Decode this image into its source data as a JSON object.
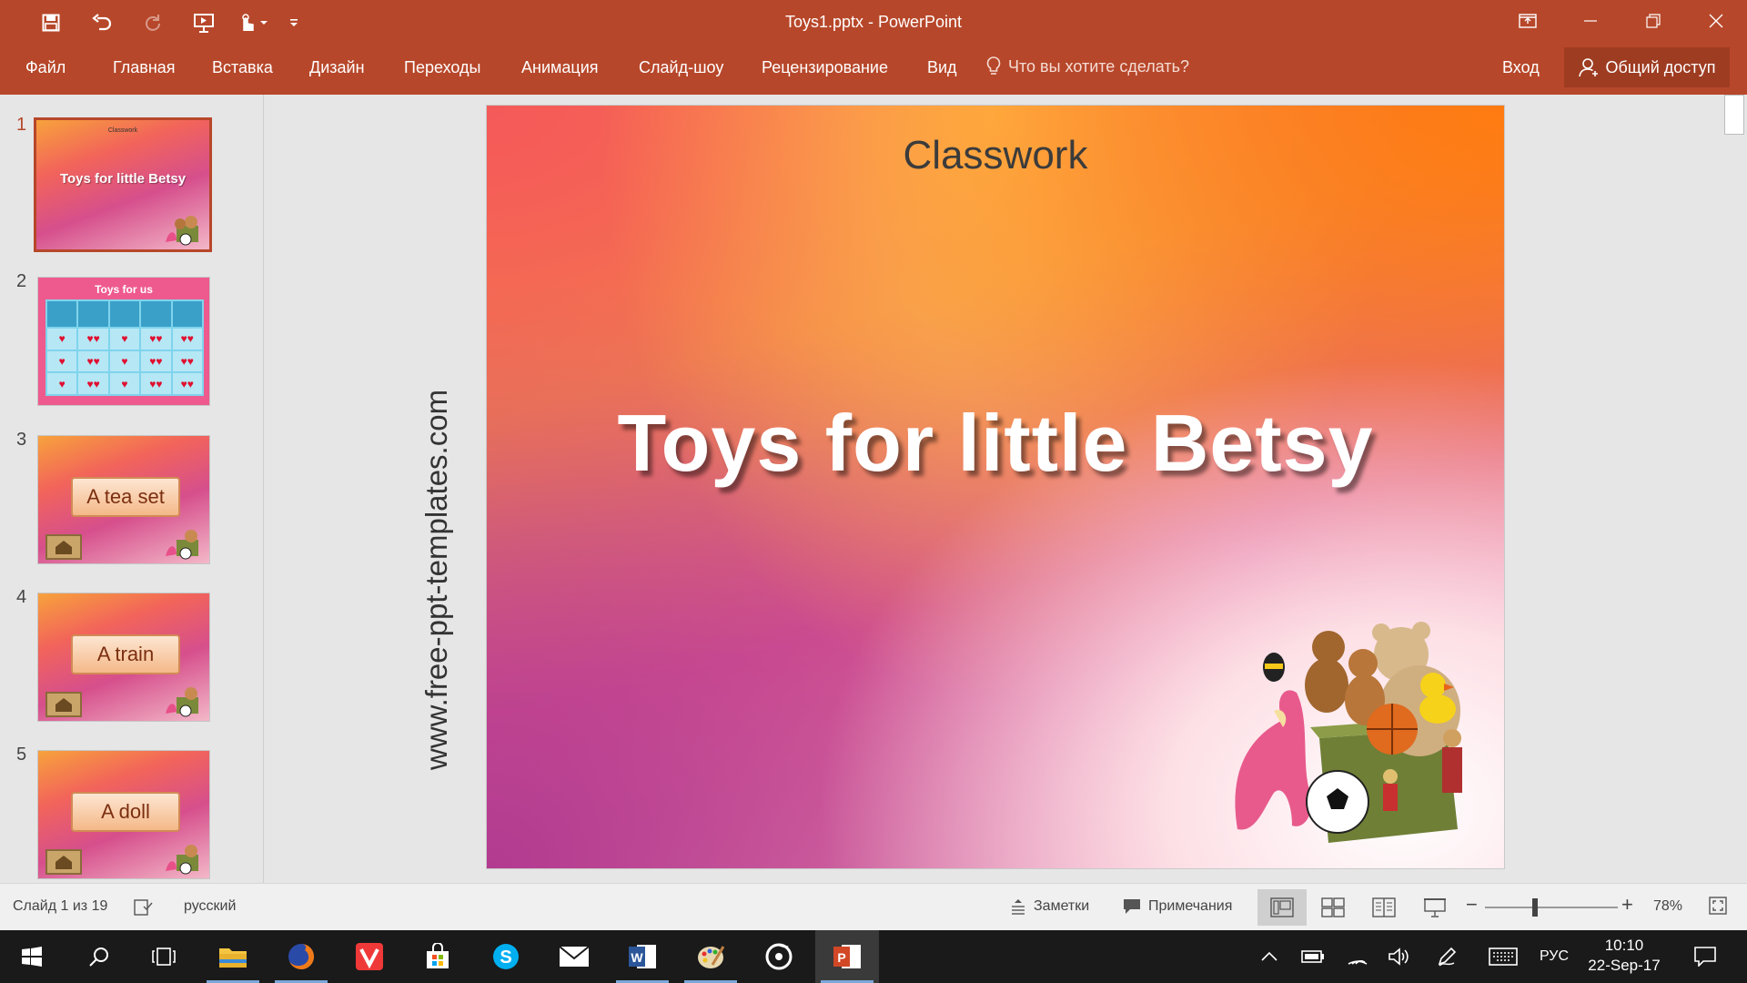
{
  "window": {
    "title": "Toys1.pptx - PowerPoint"
  },
  "quick_access": {
    "icons": [
      "save-icon",
      "undo-icon",
      "redo-icon",
      "start-from-beginning-icon",
      "touch-mode-icon",
      "customize-icon"
    ]
  },
  "ribbon_tabs": [
    {
      "label": "Файл"
    },
    {
      "label": "Главная"
    },
    {
      "label": "Вставка"
    },
    {
      "label": "Дизайн"
    },
    {
      "label": "Переходы"
    },
    {
      "label": "Анимация"
    },
    {
      "label": "Слайд-шоу"
    },
    {
      "label": "Рецензирование"
    },
    {
      "label": "Вид"
    }
  ],
  "tell_me": {
    "text": "Что вы хотите сделать?"
  },
  "account": {
    "signin": "Вход",
    "share": "Общий доступ"
  },
  "thumbnails": [
    {
      "number": "1",
      "small_title": "Classwork",
      "title": "Toys for little Betsy"
    },
    {
      "number": "2",
      "title": "Toys for us"
    },
    {
      "number": "3",
      "label": "A tea set"
    },
    {
      "number": "4",
      "label": "A train"
    },
    {
      "number": "5",
      "label": "A doll"
    }
  ],
  "slide": {
    "subtitle": "Classwork",
    "title": "Toys for little Betsy",
    "watermark": "www.free-ppt-templates.com"
  },
  "status": {
    "slide_info": "Слайд 1 из 19",
    "language": "русский",
    "notes": "Заметки",
    "comments": "Примечания",
    "zoom": "78%"
  },
  "taskbar": {
    "lang": "РУС",
    "time": "10:10",
    "date": "22-Sep-17"
  },
  "colors": {
    "accent": "#b7472a",
    "accent_dark": "#9e3c22"
  }
}
